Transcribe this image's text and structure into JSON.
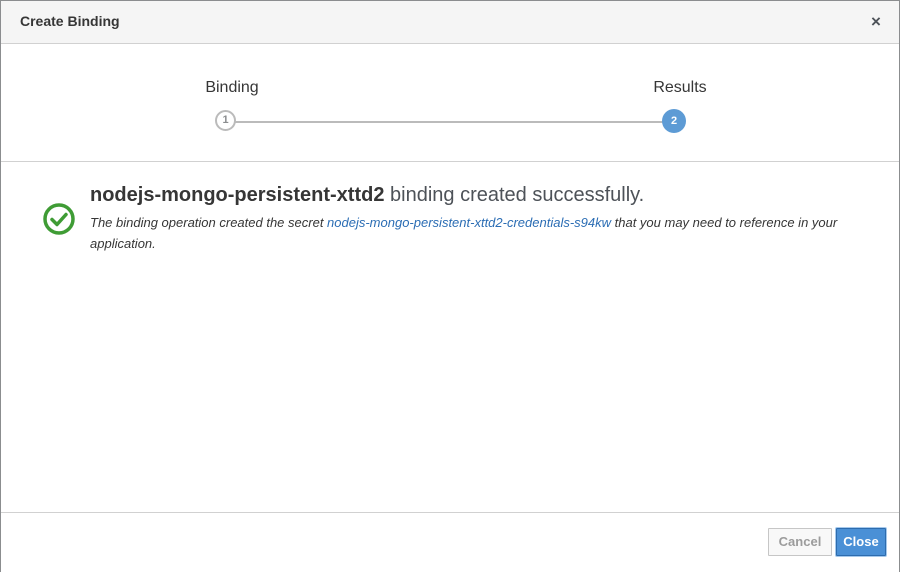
{
  "dialog": {
    "title": "Create Binding",
    "close_glyph": "×"
  },
  "wizard": {
    "steps": [
      {
        "label": "Binding",
        "number": "1",
        "state": "complete"
      },
      {
        "label": "Results",
        "number": "2",
        "state": "active"
      }
    ]
  },
  "result": {
    "icon": "check-circle-icon",
    "resource_name": "nodejs-mongo-persistent-xttd2",
    "message": " binding created successfully.",
    "detail_prefix": "The binding operation created the secret ",
    "secret_link": "nodejs-mongo-persistent-xttd2-credentials-s94kw",
    "detail_suffix": " that you may need to reference in your application."
  },
  "footer": {
    "cancel_label": "Cancel",
    "close_label": "Close"
  },
  "colors": {
    "success": "#3f9c35",
    "primary": "#4a90d6",
    "link": "#2b6db4",
    "step_active": "#5d9bd5"
  }
}
